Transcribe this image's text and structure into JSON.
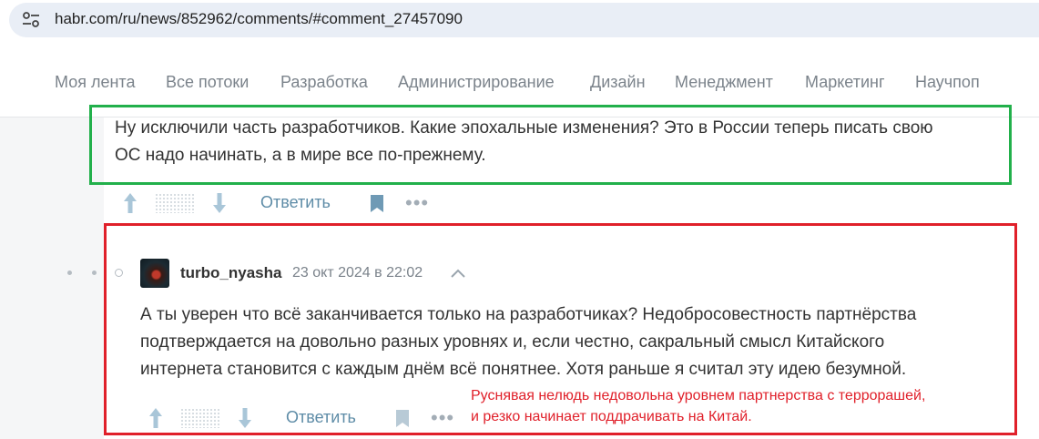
{
  "browser": {
    "url": "habr.com/ru/news/852962/comments/#comment_27457090",
    "site_info_icon": "tune-icon"
  },
  "nav": {
    "items": [
      "Моя лента",
      "Все потоки",
      "Разработка",
      "Администрирование",
      "Дизайн",
      "Менеджмент",
      "Маркетинг",
      "Научпоп"
    ]
  },
  "comment_parent": {
    "lines": [
      "Ну исключили часть разработчиков. Какие эпохальные изменения? Это в России теперь писать свою",
      "ОС надо начинать, а в мире все по-прежнему."
    ],
    "actions": {
      "reply_label": "Ответить",
      "more_label": "•••"
    }
  },
  "comment_reply": {
    "author": "turbo_nyasha",
    "datetime": "23 окт 2024 в 22:02",
    "lines": [
      "А ты уверен что всё заканчивается только на разработчиках? Недобросовестность партнёрства",
      "подтверждается на довольно разных уровнях и, если честно, сакральный смысл Китайского",
      "интернета становится с каждым днём всё понятнее. Хотя раньше я считал эту идею безумной."
    ],
    "actions": {
      "reply_label": "Ответить",
      "more_label": "•••"
    }
  },
  "annotation": {
    "lines": [
      "Руснявая нелюдь недовольна уровнем партнерства с террорашей,",
      "и резко начинает поддрачивать на Китай."
    ],
    "green_color": "#22b04b",
    "red_color": "#e0202a"
  }
}
